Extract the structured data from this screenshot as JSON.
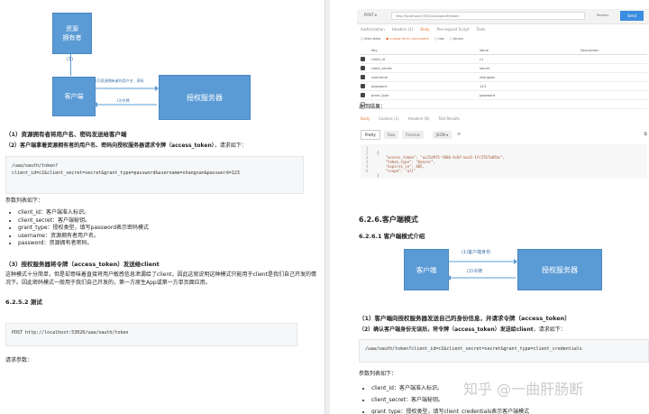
{
  "left": {
    "diagram": {
      "resource_owner": "资源\n拥有者",
      "step1": "(1)",
      "client": "客户端",
      "auth_server": "授权服务器",
      "arrow2": "(2)资源拥有者的用户名、密码",
      "arrow3": "(3)令牌"
    },
    "h1": "（1）资源拥有者将用户名、密码发送给客户端",
    "h2_bold": "（2）客户端拿着资源拥有者的用户名、密码向授权服务器请求令牌（access_token）",
    "h2_rest": "，请求如下：",
    "code1": "/uaa/oauth/token?\nclient_id=c1&client_secret=secret&grant_type=password&username=shangsan&password=123",
    "params_title": "参数列表如下：",
    "params": [
      "client_id：客户端准入标识。",
      "client_secret：客户端秘钥。",
      "grant_type：授权类型，填写password表示密码模式",
      "username：资源拥有者用户名。",
      "password：资源拥有者密码。"
    ],
    "h3": "（3）授权服务器将令牌（access_token）发送给client",
    "para": "这种模式十分简单，但是却意味着直接将用户敏感信息泄漏给了client，因此这就说明这种模式只能用于client是我们自己开发的情况下。因此密码模式一般用于我们自己开发的，第一方原生App或第一方单页面应用。",
    "sec": "6.2.5.2 测试",
    "code2": "POST http://localhost:53020/uaa/oauth/token",
    "req_params": "请求参数："
  },
  "postman": {
    "method": "POST",
    "url": "http://localhost:53020/uaa/oauth/token",
    "params_btn": "Params",
    "send_btn": "Send",
    "req_tabs": [
      "Authorization",
      "Headers (1)",
      "Body",
      "Pre-request Script",
      "Tests"
    ],
    "body_opts": [
      "form-data",
      "x-www-form-urlencoded",
      "raw",
      "binary"
    ],
    "col_key": "Key",
    "col_value": "Value",
    "col_desc": "Description",
    "rows": [
      {
        "key": "client_id",
        "value": "c1",
        "checked": true
      },
      {
        "key": "client_secret",
        "value": "secret",
        "checked": true
      },
      {
        "key": "username",
        "value": "zhangsan",
        "checked": true
      },
      {
        "key": "password",
        "value": "123",
        "checked": true
      },
      {
        "key": "grant_type",
        "value": "password",
        "checked": true
      },
      {
        "key": "",
        "value": "",
        "checked": false
      }
    ],
    "result_label": "返回结果：",
    "resp_tabs": [
      "Body",
      "Cookies (1)",
      "Headers (8)",
      "Test Results"
    ],
    "view_tabs": [
      "Pretty",
      "Raw",
      "Preview"
    ],
    "format": "JSON",
    "json_lines": [
      "{",
      "    \"access_token\": \"ac25d9f5-f08b-4c6f-bca5-1fc5767a85bc\",",
      "    \"token_type\": \"bearer\",",
      "    \"expires_in\": 485,",
      "    \"scope\": \"all\"",
      "}"
    ]
  },
  "right": {
    "h626": "6.2.6.客户端模式",
    "h6261": "6.2.6.1 客户端模式介绍",
    "diagram": {
      "client": "客户端",
      "auth_server": "授权服务器",
      "arrow1": "(1)客户端身份",
      "arrow2": "(2)令牌"
    },
    "s1": "（1）客户端向授权服务器发送自己的身份信息，并请求令牌（access_token）",
    "s2_bold": "（2）确认客户端身份无误后，将令牌（access_token）发送给client",
    "s2_rest": "，请求如下：",
    "code": "/uaa/oauth/token?client_id=c1&client_secret=secret&grant_type=client_credentials",
    "params_title": "参数列表如下：",
    "params": [
      "client_id：客户端准入标识。",
      "client_secret：客户端秘钥。",
      "grant_type：授权类型，填写client_credentials表示客户端模式"
    ],
    "watermark": "知乎 @一曲肝肠断"
  }
}
